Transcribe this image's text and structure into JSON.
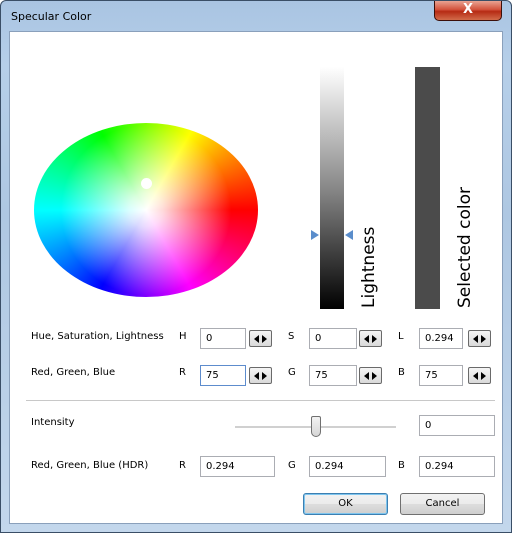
{
  "window": {
    "title": "Specular Color",
    "close_glyph": "X"
  },
  "labels": {
    "lightness": "Lightness",
    "selected_color": "Selected color",
    "hsl": "Hue, Saturation, Lightness",
    "rgb": "Red, Green, Blue",
    "intensity": "Intensity",
    "rgb_hdr": "Red, Green, Blue (HDR)"
  },
  "hsl": {
    "h_label": "H",
    "h": "0",
    "s_label": "S",
    "s": "0",
    "l_label": "L",
    "l": "0.294"
  },
  "rgb": {
    "r_label": "R",
    "r": "75",
    "g_label": "G",
    "g": "75",
    "b_label": "B",
    "b": "75"
  },
  "intensity": {
    "value": "0"
  },
  "hdr": {
    "r_label": "R",
    "r": "0.294",
    "g_label": "G",
    "g": "0.294",
    "b_label": "B",
    "b": "0.294"
  },
  "buttons": {
    "ok": "OK",
    "cancel": "Cancel"
  },
  "colors": {
    "selected": "#4b4b4b",
    "marker": "#5a8dcb"
  },
  "icons": {
    "close": "close-icon",
    "spin": "spin-arrows-icon"
  }
}
